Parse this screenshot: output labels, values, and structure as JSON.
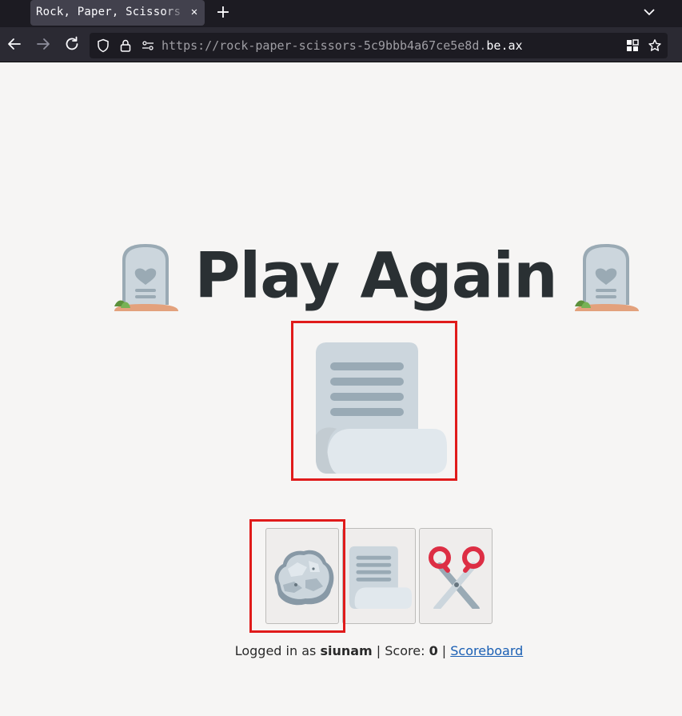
{
  "browser": {
    "tab_title": "Rock, Paper, Scissors",
    "url_prefix": "https://rock-paper-scissors-5c9bbb4a67ce5e8d.",
    "url_host": "be.ax",
    "icons": [
      "back-icon",
      "forward-icon",
      "reload-icon",
      "shield-icon",
      "lock-icon",
      "permissions-icon",
      "qr-code-icon",
      "bookmark-star-icon",
      "close-icon",
      "plus-icon",
      "chevron-down-icon"
    ]
  },
  "page": {
    "heading": "Play Again",
    "heading_icon": "headstone-icon",
    "result_choice": "paper-icon",
    "choices": [
      {
        "name": "rock",
        "icon": "rock-icon",
        "selected": true
      },
      {
        "name": "paper",
        "icon": "paper-icon",
        "selected": false
      },
      {
        "name": "scissors",
        "icon": "scissors-icon",
        "selected": false
      }
    ],
    "status": {
      "logged_in_prefix": "Logged in as ",
      "username": "siunam",
      "score_prefix": " | Score: ",
      "score": "0",
      "separator": " | ",
      "scoreboard_link": "Scoreboard"
    },
    "highlight_color": "#e01b1b"
  }
}
